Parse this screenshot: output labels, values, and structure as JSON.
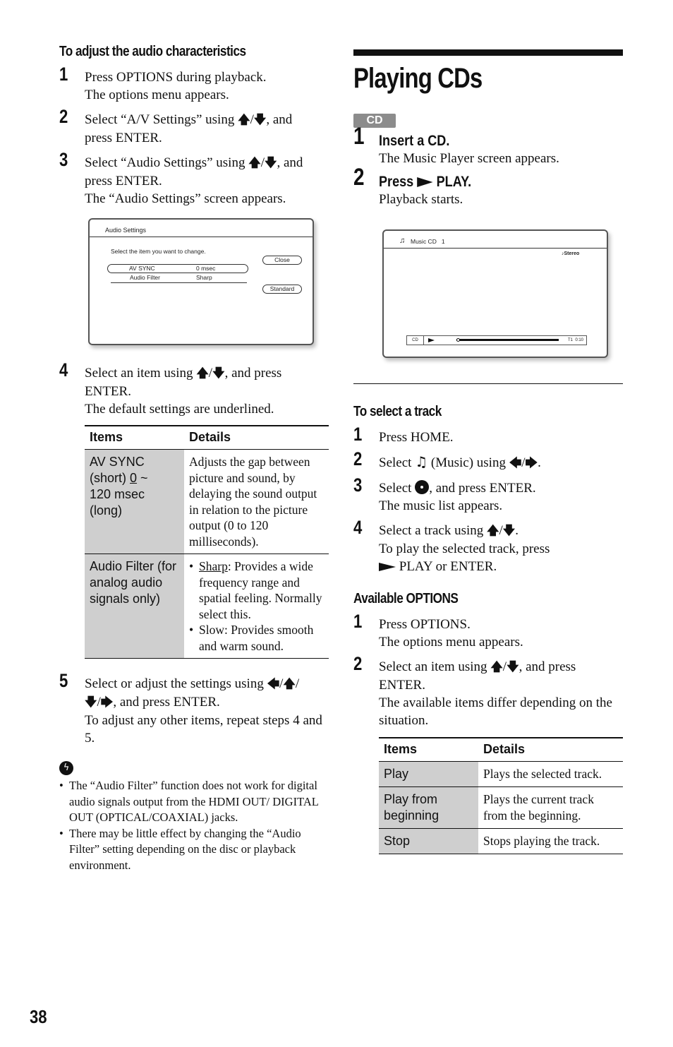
{
  "page_number": "38",
  "left": {
    "heading": "To adjust the audio characteristics",
    "steps": [
      {
        "num": "1",
        "lines": [
          "Press OPTIONS during playback.",
          "The options menu appears."
        ]
      },
      {
        "num": "2",
        "pre": "Select “A/V Settings” using ",
        "post": ", and",
        "cont": "press ENTER."
      },
      {
        "num": "3",
        "pre": "Select “Audio Settings” using ",
        "post": ", and",
        "cont": "press ENTER.",
        "extra": "The “Audio Settings” screen appears."
      },
      {
        "num": "4",
        "pre": "Select an item using ",
        "post": ", and press",
        "cont": "ENTER.",
        "extra": "The default settings are underlined."
      },
      {
        "num": "5",
        "pre": "Select or adjust the settings using ",
        "post": "",
        "cont_post": ", and press ENTER.",
        "extra": "To adjust any other items, repeat steps 4 and 5."
      }
    ],
    "arrows": {
      "up": "🡅",
      "down": "🡇",
      "left": "🡄",
      "right": "🡆",
      "sep": "/"
    },
    "audio_settings_screen": {
      "title": "Audio Settings",
      "prompt": "Select the item you want to change.",
      "rows": [
        {
          "label": "AV SYNC",
          "value": "0 msec",
          "selected": true
        },
        {
          "label": "Audio Filter",
          "value": "Sharp",
          "selected": false
        }
      ],
      "buttons": [
        "Close",
        "Standard"
      ]
    },
    "table": {
      "headers": [
        "Items",
        "Details"
      ],
      "rows": [
        {
          "item_lines": [
            "AV SYNC",
            "(short) ",
            "0",
            " ~",
            "120 msec",
            "(long)"
          ],
          "details": "Adjusts the gap between picture and sound, by delaying the sound output in relation to the picture output (0 to 120 milliseconds)."
        },
        {
          "item": "Audio Filter (for analog audio signals only)",
          "bullets": [
            {
              "underlined": "Sharp",
              "rest": ": Provides a wide frequency range and spatial feeling. Normally select this."
            },
            {
              "underlined": "",
              "rest": "Slow: Provides smooth and warm sound."
            }
          ]
        }
      ]
    },
    "hint": {
      "icon": "hint-icon",
      "items": [
        "The “Audio Filter” function does not work for digital audio signals output from the HDMI OUT/ DIGITAL OUT (OPTICAL/COAXIAL) jacks.",
        "There may be little effect by changing the “Audio Filter” setting depending on the disc or playback environment."
      ]
    }
  },
  "right": {
    "title": "Playing CDs",
    "badge": "CD",
    "steps": [
      {
        "num": "1",
        "bold": "Insert a CD.",
        "sub": "The Music Player screen appears."
      },
      {
        "num": "2",
        "bold_pre": "Press ",
        "bold_post": " PLAY.",
        "sub": "Playback starts."
      }
    ],
    "music_screen": {
      "title": "Music CD   1",
      "audio_mode": "Stereo",
      "source": "CD",
      "track_time": "T1  0:10",
      "progress_fraction": 0.0
    },
    "select_track": {
      "heading": "To select a track",
      "steps": [
        {
          "num": "1",
          "text": "Press HOME."
        },
        {
          "num": "2",
          "pre": "Select ",
          "mid": " (Music) using ",
          "post": "."
        },
        {
          "num": "3",
          "pre": "Select ",
          "post": ", and press ENTER.",
          "extra": "The music list appears."
        },
        {
          "num": "4",
          "pre": "Select a track using ",
          "post": ".",
          "extra": "To play the selected track, press",
          "extra2": " PLAY or ENTER."
        }
      ]
    },
    "options": {
      "heading": "Available OPTIONS",
      "steps": [
        {
          "num": "1",
          "lines": [
            "Press OPTIONS.",
            "The options menu appears."
          ]
        },
        {
          "num": "2",
          "pre": "Select an item using ",
          "post": ", and press",
          "cont": "ENTER.",
          "extra": "The available items differ depending on the situation."
        }
      ],
      "table": {
        "headers": [
          "Items",
          "Details"
        ],
        "rows": [
          {
            "item": "Play",
            "details": "Plays the selected track."
          },
          {
            "item": "Play from beginning",
            "details": "Plays the current track from the beginning."
          },
          {
            "item": "Stop",
            "details": "Stops playing the track."
          }
        ]
      }
    }
  }
}
